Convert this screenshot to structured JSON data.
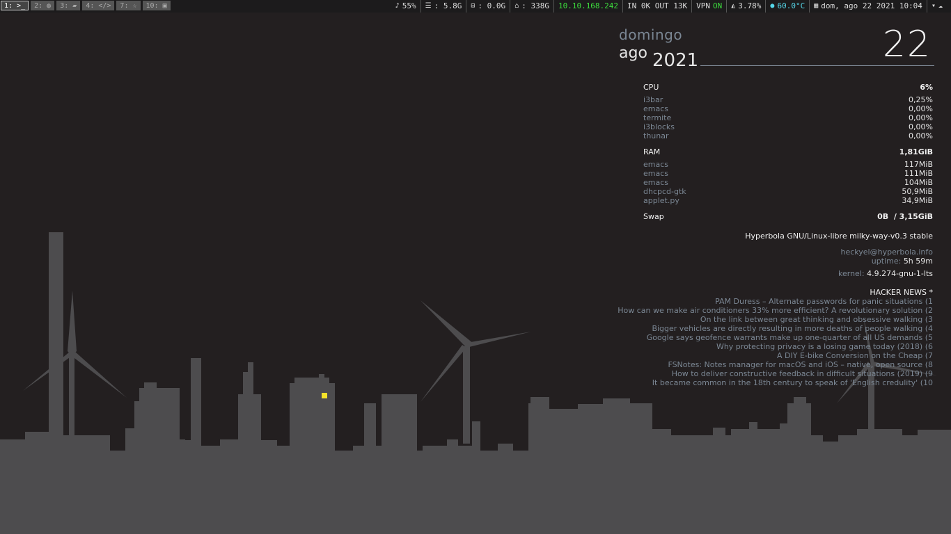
{
  "bar": {
    "workspaces": [
      {
        "label": "1: >_",
        "focused": true
      },
      {
        "label": "2: ◍",
        "focused": false
      },
      {
        "label": "3: ▰",
        "focused": false
      },
      {
        "label": "4: </>",
        "focused": false
      },
      {
        "label": "7: ☆",
        "focused": false
      },
      {
        "label": "10: ▣",
        "focused": false
      }
    ],
    "volume": "55%",
    "disk1": ": 5.8G",
    "disk2": ": 0.0G",
    "home": ": 338G",
    "ip": "10.10.168.242",
    "net": "IN 0K OUT 13K",
    "vpn_label": "VPN",
    "vpn_state": "ON",
    "cpu": "3.78%",
    "temp": "60.0°C",
    "datetime": "dom, ago 22 2021 10:04"
  },
  "date": {
    "day_name": "domingo",
    "month": "ago",
    "year": "2021",
    "day": "22"
  },
  "cpu": {
    "label": "CPU",
    "total": "6%",
    "procs": [
      {
        "name": "i3bar",
        "value": "0,25%"
      },
      {
        "name": "emacs",
        "value": "0,00%"
      },
      {
        "name": "termite",
        "value": "0,00%"
      },
      {
        "name": "i3blocks",
        "value": "0,00%"
      },
      {
        "name": "thunar",
        "value": "0,00%"
      }
    ]
  },
  "ram": {
    "label": "RAM",
    "total": "1,81GiB",
    "procs": [
      {
        "name": "emacs",
        "value": "117MiB"
      },
      {
        "name": "emacs",
        "value": "111MiB"
      },
      {
        "name": "emacs",
        "value": "104MiB"
      },
      {
        "name": "dhcpcd-gtk",
        "value": "50,9MiB"
      },
      {
        "name": "applet.py",
        "value": "34,9MiB"
      }
    ]
  },
  "swap": {
    "label": "Swap",
    "value": "0B  / 3,15GiB"
  },
  "system": {
    "distro": "Hyperbola GNU/Linux-libre milky-way-v0.3 stable",
    "user_host": "heckyel@hyperbola.info",
    "uptime_label": "uptime:",
    "uptime": "5h 59m",
    "kernel_label": "kernel:",
    "kernel": "4.9.274-gnu-1-lts"
  },
  "hacker_news": {
    "title": "HACKER NEWS *",
    "items": [
      "PAM Duress – Alternate passwords for panic situations  (1",
      "How can we make air conditioners 33% more efficient? A revolutionary solution  (2",
      "On the link between great thinking and obsessive walking  (3",
      "Bigger vehicles are directly resulting in more deaths of people walking  (4",
      "Google says geofence warrants make up one-quarter of all US demands  (5",
      "Why protecting privacy is a losing game today (2018)  (6",
      "A DIY E-bike Conversion on the Cheap  (7",
      "FSNotes: Notes manager for macOS and iOS – native, open source  (8",
      "How to deliver constructive feedback in difficult situations (2019)  (9",
      "It became common in the 18th century to speak of 'English credulity'  (10"
    ]
  },
  "colors": {
    "background": "#231f20",
    "skyline": "#4d4c4e",
    "window_light": "#f5e32a",
    "accent_green": "#3ddc3d",
    "accent_cyan": "#55d6e8",
    "muted": "#7b8794"
  }
}
